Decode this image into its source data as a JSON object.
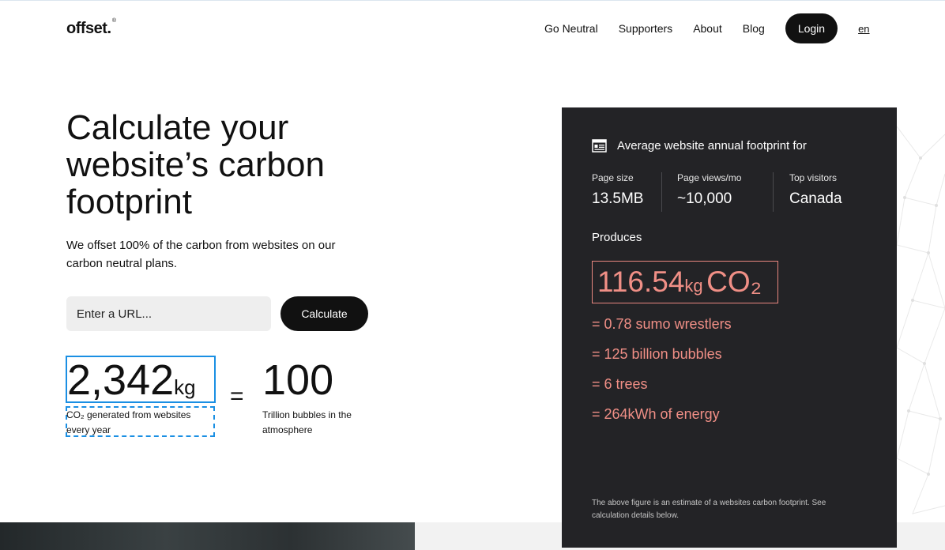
{
  "header": {
    "logo": "offset.",
    "logo_mark": "®",
    "nav": [
      {
        "label": "Go Neutral"
      },
      {
        "label": "Supporters"
      },
      {
        "label": "About"
      },
      {
        "label": "Blog"
      }
    ],
    "login_label": "Login",
    "language": "en"
  },
  "hero": {
    "title": "Calculate your website’s carbon footprint",
    "subtitle": "We offset 100% of the carbon from websites on our carbon neutral plans.",
    "url_placeholder": "Enter a URL...",
    "calculate_label": "Calculate"
  },
  "stats": {
    "co2_value": "2,342",
    "co2_unit": "kg",
    "co2_caption": "CO₂ generated from websites every year",
    "equals": "=",
    "bubbles_value": "100",
    "bubbles_caption": "Trillion bubbles in the atmosphere"
  },
  "card": {
    "heading": "Average website annual footprint for",
    "icon": "browser-window-icon",
    "metrics": [
      {
        "label": "Page size",
        "value": "13.5MB"
      },
      {
        "label": "Page views/mo",
        "value": "~10,000"
      },
      {
        "label": "Top visitors",
        "value": "Canada"
      }
    ],
    "produces_label": "Produces",
    "co2_amount": "116.54",
    "co2_unit": "kg",
    "co2_label": "CO₂",
    "equivalents": [
      "= 0.78 sumo wrestlers",
      "= 125 billion bubbles",
      "= 6 trees",
      "= 264kWh of energy"
    ],
    "note": "The above figure is an estimate of a websites carbon footprint. See calculation details below."
  },
  "colors": {
    "accent": "#f08f86",
    "card_bg": "#232326",
    "selection": "#1a8fe3"
  }
}
